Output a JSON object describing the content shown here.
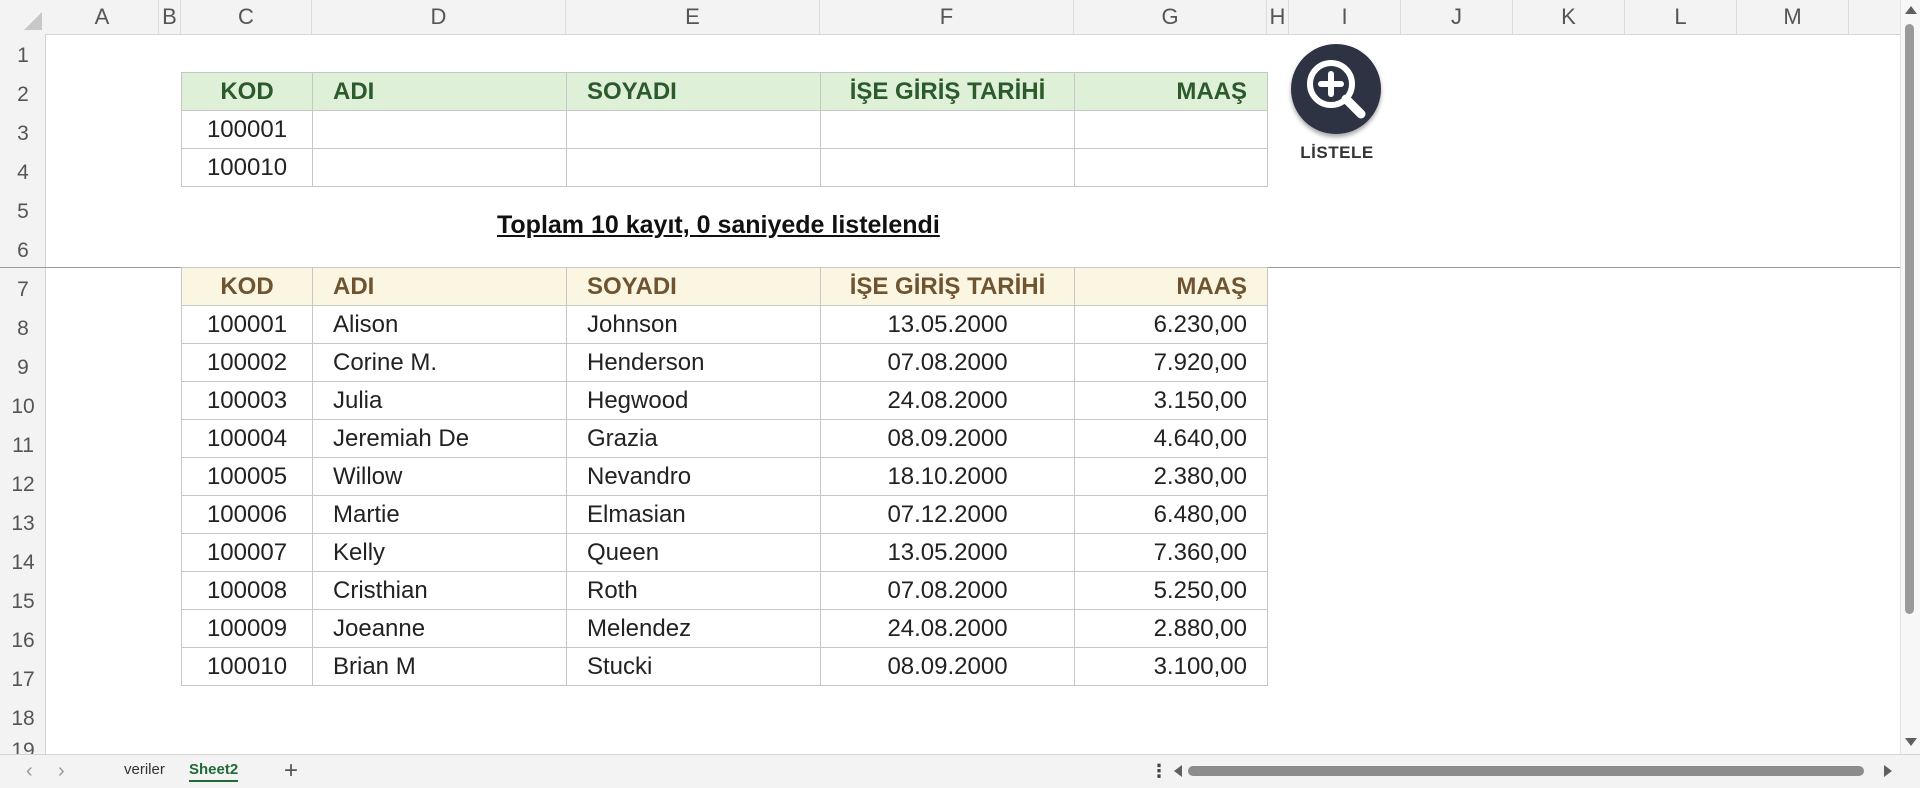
{
  "columns": [
    "A",
    "B",
    "C",
    "D",
    "E",
    "F",
    "G",
    "H",
    "I",
    "J",
    "K",
    "L",
    "M"
  ],
  "rows": [
    "1",
    "2",
    "3",
    "4",
    "5",
    "6",
    "7",
    "8",
    "9",
    "10",
    "11",
    "12",
    "13",
    "14",
    "15",
    "16",
    "17",
    "18",
    "19"
  ],
  "headers": [
    "KOD",
    "ADI",
    "SOYADI",
    "İŞE GİRİŞ TARİHİ",
    "MAAŞ"
  ],
  "search_rows": [
    {
      "kod": "100001",
      "adi": "",
      "soyadi": "",
      "ise": "",
      "maas": ""
    },
    {
      "kod": "100010",
      "adi": "",
      "soyadi": "",
      "ise": "",
      "maas": ""
    }
  ],
  "status_text": "Toplam 10 kayıt, 0 saniyede listelendi",
  "results": [
    {
      "kod": "100001",
      "adi": "Alison",
      "soyadi": "Johnson",
      "ise": "13.05.2000",
      "maas": "6.230,00"
    },
    {
      "kod": "100002",
      "adi": "Corine M.",
      "soyadi": "Henderson",
      "ise": "07.08.2000",
      "maas": "7.920,00"
    },
    {
      "kod": "100003",
      "adi": "Julia",
      "soyadi": "Hegwood",
      "ise": "24.08.2000",
      "maas": "3.150,00"
    },
    {
      "kod": "100004",
      "adi": "Jeremiah De",
      "soyadi": "Grazia",
      "ise": "08.09.2000",
      "maas": "4.640,00"
    },
    {
      "kod": "100005",
      "adi": "Willow",
      "soyadi": "Nevandro",
      "ise": "18.10.2000",
      "maas": "2.380,00"
    },
    {
      "kod": "100006",
      "adi": "Martie",
      "soyadi": "Elmasian",
      "ise": "07.12.2000",
      "maas": "6.480,00"
    },
    {
      "kod": "100007",
      "adi": "Kelly",
      "soyadi": "Queen",
      "ise": "13.05.2000",
      "maas": "7.360,00"
    },
    {
      "kod": "100008",
      "adi": "Cristhian",
      "soyadi": "Roth",
      "ise": "07.08.2000",
      "maas": "5.250,00"
    },
    {
      "kod": "100009",
      "adi": "Joeanne",
      "soyadi": "Melendez",
      "ise": "24.08.2000",
      "maas": "2.880,00"
    },
    {
      "kod": "100010",
      "adi": "Brian M",
      "soyadi": "Stucki",
      "ise": "08.09.2000",
      "maas": "3.100,00"
    }
  ],
  "listele_button": {
    "label": "LİSTELE",
    "icon": "zoom-in-icon"
  },
  "sheet_tabs": [
    "veriler",
    "Sheet2"
  ],
  "active_tab": "Sheet2",
  "add_sheet_label": "+",
  "more_label": "⋮",
  "colors": {
    "top_header_bg": "#dff0d8",
    "top_header_text": "#2d5a2d",
    "bottom_header_bg": "#fbf6e1",
    "bottom_header_text": "#6e5430",
    "button_bg": "#2d3342",
    "active_tab": "#1e6b35"
  }
}
